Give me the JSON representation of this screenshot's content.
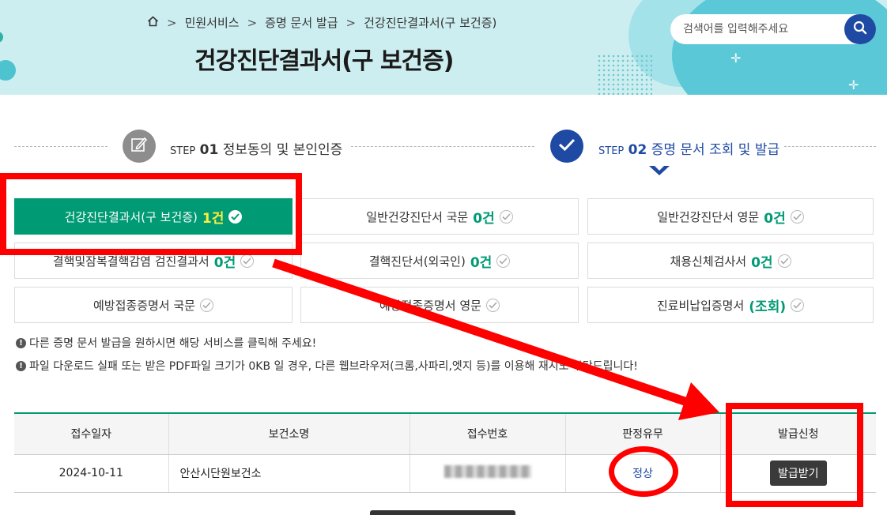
{
  "breadcrumb": {
    "items": [
      "민원서비스",
      "증명 문서 발급",
      "건강진단결과서(구 보건증)"
    ]
  },
  "page": {
    "title": "건강진단결과서(구 보건증)"
  },
  "search": {
    "placeholder": "검색어를 입력해주세요"
  },
  "steps": [
    {
      "prefix": "STEP",
      "num": "01",
      "label": "정보동의 및 본인인증",
      "state": "done"
    },
    {
      "prefix": "STEP",
      "num": "02",
      "label": "증명 문서 조회 및 발급",
      "state": "current"
    }
  ],
  "certificates": [
    {
      "name": "건강진단결과서(구 보건증)",
      "count": "1건",
      "active": true
    },
    {
      "name": "일반건강진단서 국문",
      "count": "0건",
      "active": false
    },
    {
      "name": "일반건강진단서 영문",
      "count": "0건",
      "active": false
    },
    {
      "name": "결핵및잠복결핵감염 검진결과서",
      "count": "0건",
      "active": false
    },
    {
      "name": "결핵진단서(외국인)",
      "count": "0건",
      "active": false
    },
    {
      "name": "채용신체검사서",
      "count": "0건",
      "active": false
    },
    {
      "name": "예방접종증명서 국문",
      "count": "",
      "active": false
    },
    {
      "name": "예방접종증명서 영문",
      "count": "",
      "active": false
    },
    {
      "name": "진료비납입증명서",
      "count": "(조회)",
      "active": false
    }
  ],
  "notices": [
    "다른 증명 문서 발급을 원하시면 해당 서비스를 클릭해 주세요!",
    "파일 다운로드 실패 또는 받은 PDF파일 크기가 0KB 일 경우, 다른 웹브라우저(크롬,사파리,엣지 등)를 이용해 재시도 부탁드립니다!"
  ],
  "table": {
    "headers": [
      "접수일자",
      "보건소명",
      "접수번호",
      "판정유무",
      "발급신청"
    ],
    "rows": [
      {
        "date": "2024-10-11",
        "center": "안산시단원보건소",
        "receipt_no": "",
        "result": "정상",
        "action": "발급받기"
      }
    ]
  },
  "colors": {
    "accent_green": "#009a74",
    "accent_blue": "#1f4aa3",
    "annotation_red": "#ff0000"
  }
}
